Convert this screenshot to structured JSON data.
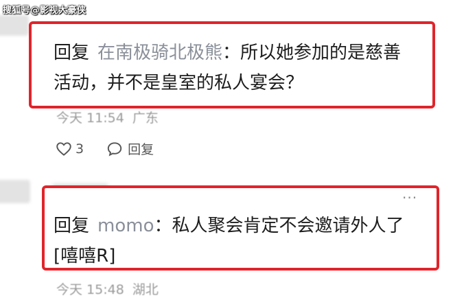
{
  "watermark": "搜狐号@影视大豪侠",
  "comment1": {
    "reply_word": "回复",
    "username": "在南极骑北极熊",
    "separator": "：",
    "text_line1": "所以她参加的是慈善",
    "text_line2": "活动，并不是皇室的私人宴会？",
    "time": "今天 11:54",
    "location": "广东",
    "likes": "3",
    "reply_label": "回复"
  },
  "comment2": {
    "reply_word": "回复",
    "username": "momo",
    "separator": "：",
    "text_line1": "私人聚会肯定不会邀请外人了",
    "text_line2": "[嘻嘻R]",
    "time": "今天 15:48",
    "location": "湖北",
    "more": "···"
  }
}
